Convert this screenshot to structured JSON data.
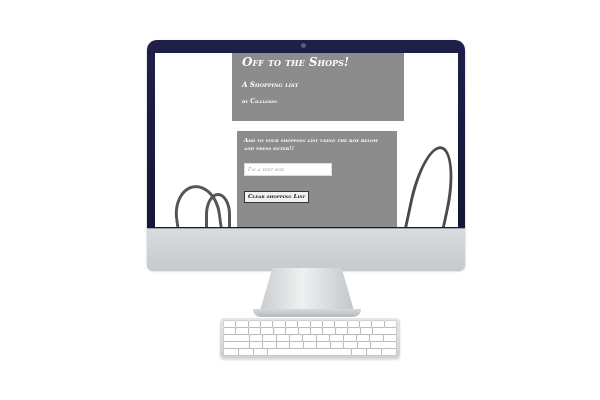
{
  "page": {
    "title": "Off to the Shops!",
    "subtitle": "A Shopping list",
    "author": "by Cilliandc"
  },
  "shopping_form": {
    "instructions": "Add to your shopping list using the box below and press enter!!",
    "input_placeholder": "I'm a text box",
    "clear_button_label": "Clear shopping List"
  },
  "colors": {
    "panel_background": "#8c8c8c",
    "monitor_bezel": "#1f1f4a",
    "text_on_panel": "#ffffff"
  },
  "icons": {
    "background_image": "shopping-bag-handles"
  }
}
